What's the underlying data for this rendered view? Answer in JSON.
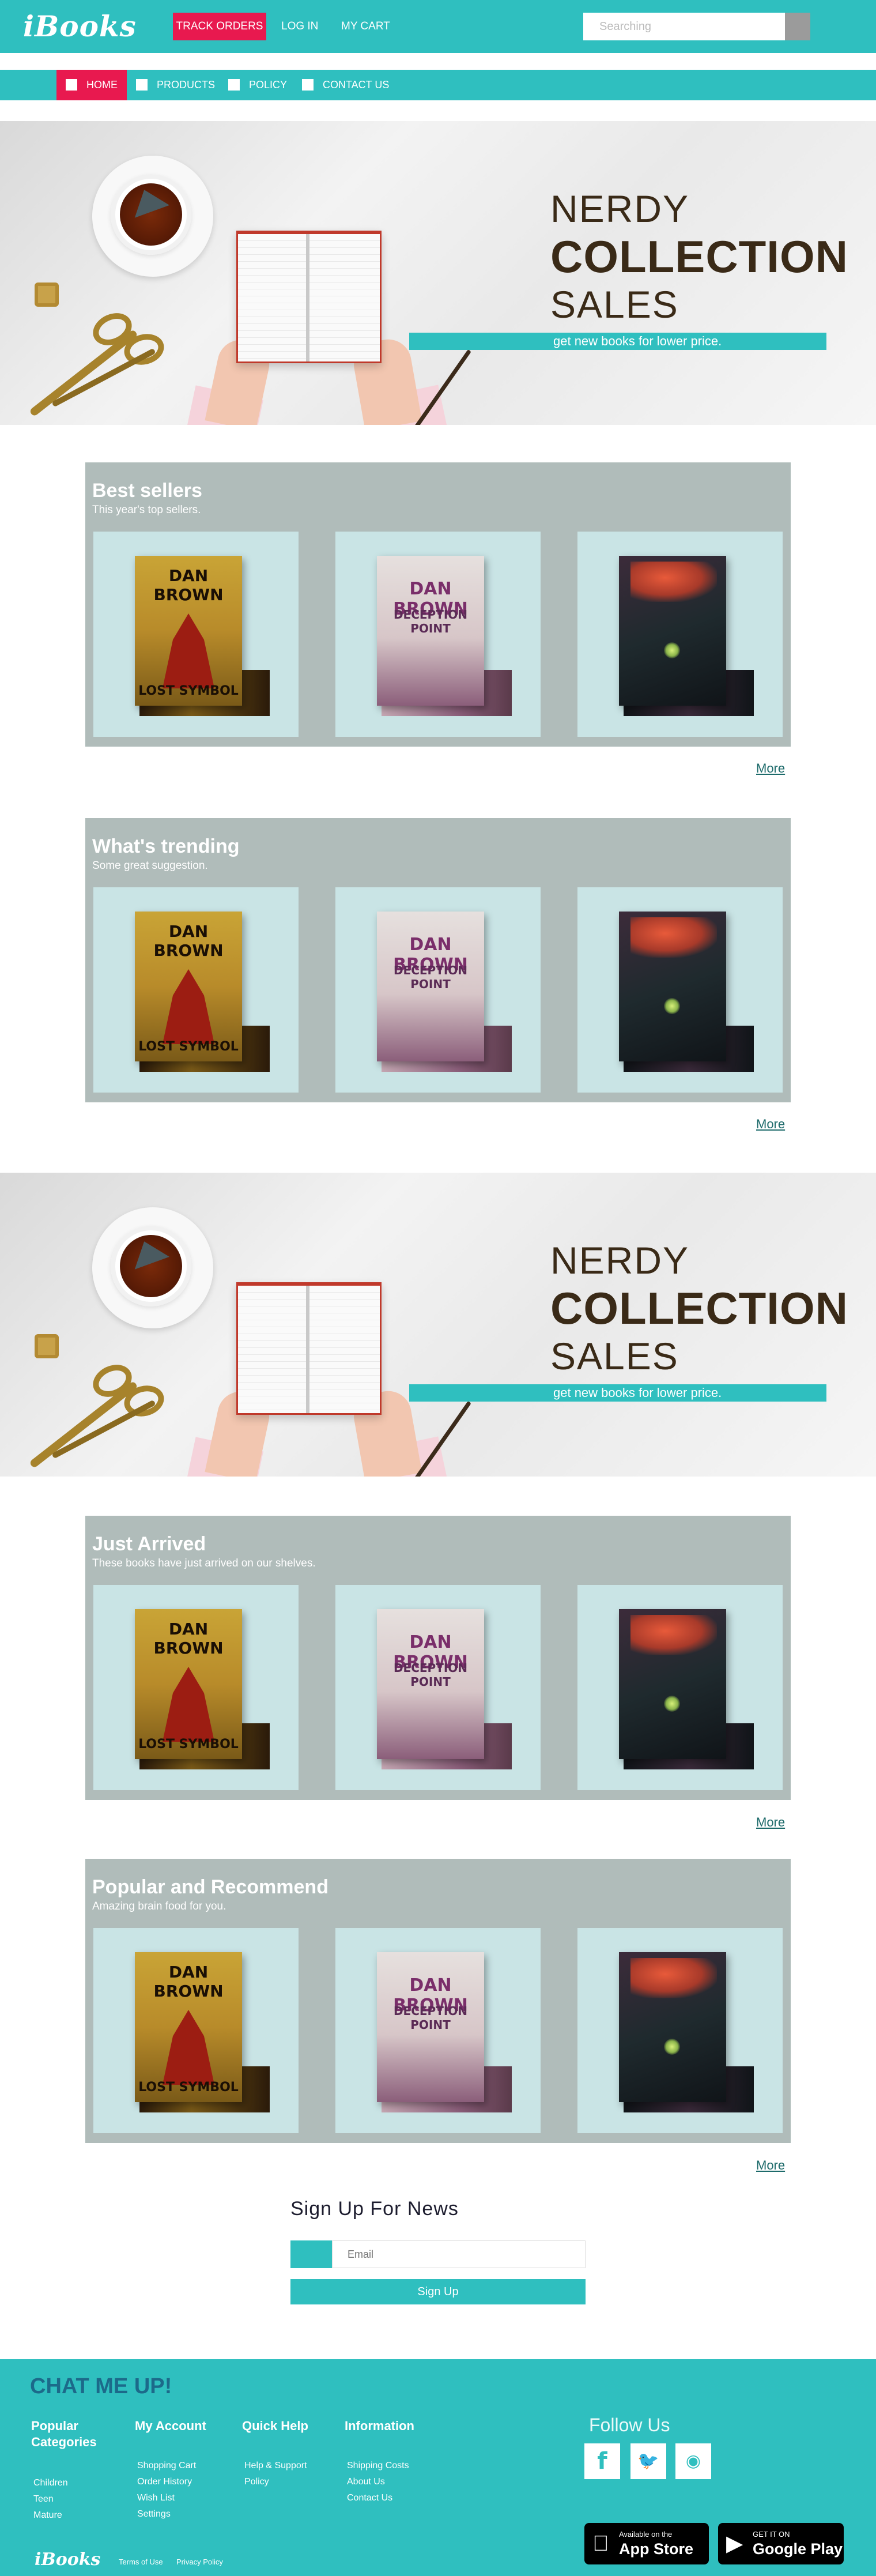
{
  "header": {
    "logo": "iBooks",
    "track_orders": "TRACK ORDERS",
    "login": "LOG IN",
    "cart": "MY CART",
    "search_placeholder": "Searching"
  },
  "nav": {
    "items": [
      "HOME",
      "PRODUCTS",
      "POLICY",
      "CONTACT US"
    ]
  },
  "hero": {
    "line1": "NERDY",
    "line2": "COLLECTION",
    "line3": "SALES",
    "tagline": "get new books for lower price."
  },
  "sections": [
    {
      "title": "Best sellers",
      "subtitle": "This year's top sellers.",
      "more": "More"
    },
    {
      "title": "What's trending",
      "subtitle": "Some great suggestion.",
      "more": "More"
    },
    {
      "title": "Just Arrived",
      "subtitle": "These books have just arrived on our shelves.",
      "more": "More"
    },
    {
      "title": "Popular and Recommend",
      "subtitle": "Amazing brain food for you.",
      "more": "More"
    }
  ],
  "books": [
    {
      "author": "DAN BROWN",
      "title": "LOST SYMBOL",
      "back": "THE LOST SYMBOL"
    },
    {
      "author": "DAN BROWN",
      "title": "DECEPTION POINT",
      "back": "DECEPTION POINT"
    },
    {
      "author": "",
      "title": "",
      "back": ""
    }
  ],
  "newsletter": {
    "title": "Sign Up For News",
    "email_placeholder": "Email",
    "button": "Sign Up"
  },
  "footer": {
    "chat": "CHAT ME UP!",
    "col1": {
      "title": "Popular Categories",
      "links": [
        "Children",
        "Teen",
        "Mature"
      ]
    },
    "col2": {
      "title": "My Account",
      "links": [
        "Shopping Cart",
        "Order History",
        "Wish List",
        "Settings"
      ]
    },
    "col3": {
      "title": "Quick Help",
      "links": [
        "Help & Support",
        "Policy"
      ]
    },
    "col4": {
      "title": "Information",
      "links": [
        "Shipping Costs",
        "About Us",
        "Contact Us"
      ]
    },
    "follow": "Follow Us",
    "appstore_small": "Available on the",
    "appstore": "App Store",
    "gplay_small": "GET IT ON",
    "gplay": "Google Play",
    "logo": "iBooks",
    "terms": "Terms of Use",
    "privacy": "Privacy Policy"
  },
  "colors": {
    "accent": "#2fbfbf",
    "highlight": "#e8194f",
    "section_bg": "#b0bcba",
    "card_bg": "#c9e4e5"
  }
}
